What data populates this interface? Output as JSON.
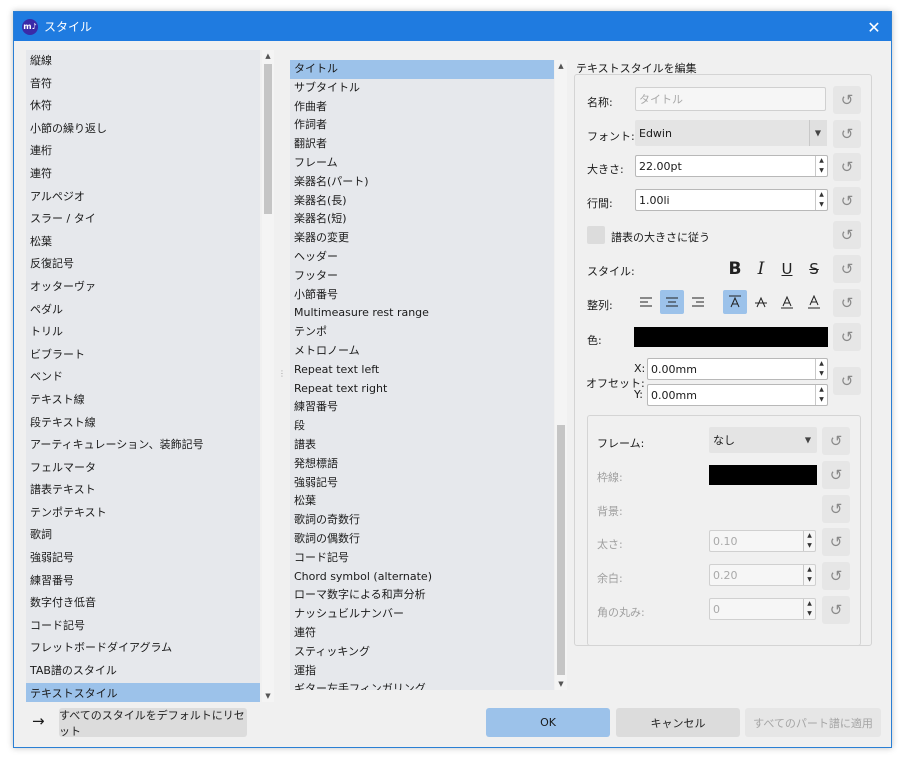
{
  "window": {
    "title": "スタイル",
    "app_icon_text": "m♪"
  },
  "left_list": {
    "items": [
      "縦線",
      "音符",
      "休符",
      "小節の繰り返し",
      "連桁",
      "連符",
      "アルペジオ",
      "スラー / タイ",
      "松葉",
      "反復記号",
      "オッターヴァ",
      "ペダル",
      "トリル",
      "ビブラート",
      "ベンド",
      "テキスト線",
      "段テキスト線",
      "アーティキュレーション、装飾記号",
      "フェルマータ",
      "譜表テキスト",
      "テンポテキスト",
      "歌詞",
      "強弱記号",
      "練習番号",
      "数字付き低音",
      "コード記号",
      "フレットボードダイアグラム",
      "TAB譜のスタイル",
      "テキストスタイル"
    ],
    "selected_index": 28
  },
  "mid_list": {
    "items": [
      "タイトル",
      "サブタイトル",
      "作曲者",
      "作詞者",
      "翻訳者",
      "フレーム",
      "楽器名(パート)",
      "楽器名(長)",
      "楽器名(短)",
      "楽器の変更",
      "ヘッダー",
      "フッター",
      "小節番号",
      "Multimeasure rest range",
      "テンポ",
      "メトロノーム",
      "Repeat text left",
      "Repeat text right",
      "練習番号",
      "段",
      "譜表",
      "発想標語",
      "強弱記号",
      "松葉",
      "歌詞の奇数行",
      "歌詞の偶数行",
      "コード記号",
      "Chord symbol (alternate)",
      "ローマ数字による和声分析",
      "ナッシュビルナンバー",
      "連符",
      "スティッキング",
      "運指",
      "ギター左手フィンガリング"
    ],
    "selected_index": 0
  },
  "editor": {
    "group_title": "テキストスタイルを編集",
    "name_label": "名称:",
    "name_placeholder": "タイトル",
    "font_label": "フォント:",
    "font_value": "Edwin",
    "size_label": "大きさ:",
    "size_value": "22.00pt",
    "spacing_label": "行間:",
    "spacing_value": "1.00li",
    "follow_staff_label": "譜表の大きさに従う",
    "style_label": "スタイル:",
    "align_label": "整列:",
    "color_label": "色:",
    "color_value": "#000000",
    "offset_label": "オフセット:",
    "offset_x_label": "X:",
    "offset_x_value": "0.00mm",
    "offset_y_label": "Y:",
    "offset_y_value": "0.00mm",
    "frame_label": "フレーム:",
    "frame_value": "なし",
    "border_label": "枠線:",
    "border_color": "#000000",
    "background_label": "背景:",
    "thickness_label": "太さ:",
    "thickness_value": "0.10",
    "padding_label": "余白:",
    "padding_value": "0.20",
    "corner_label": "角の丸み:",
    "corner_value": "0",
    "reset_glyph": "↺",
    "bold_glyph": "B",
    "italic_glyph": "I",
    "underline_glyph": "U",
    "strike_glyph": "S"
  },
  "footer": {
    "arrow_glyph": "→",
    "reset_all_label": "すべてのスタイルをデフォルトにリセット",
    "ok_label": "OK",
    "cancel_label": "キャンセル",
    "apply_all_label": "すべてのパート譜に適用"
  }
}
